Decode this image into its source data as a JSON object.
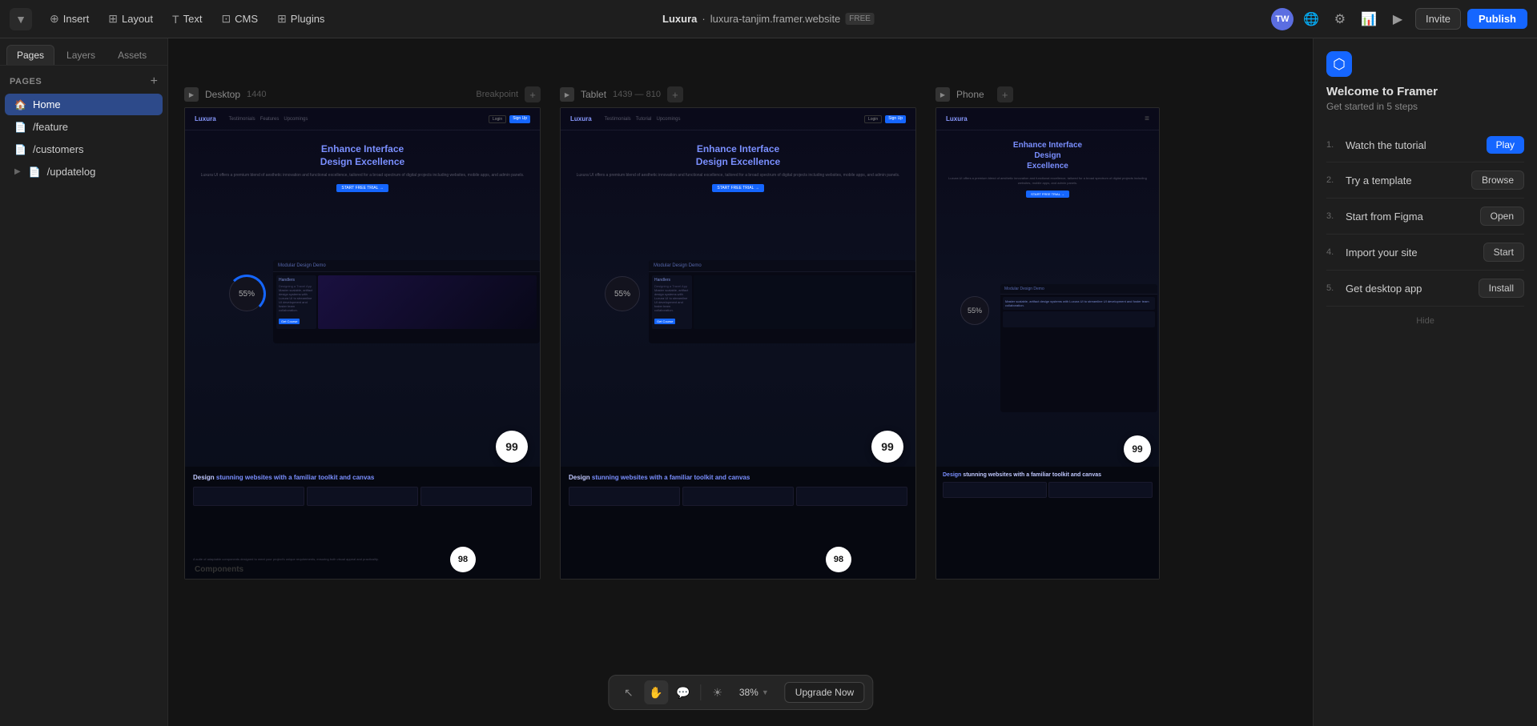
{
  "app": {
    "title": "Framer"
  },
  "topnav": {
    "logo_label": "▼",
    "insert_label": "Insert",
    "layout_label": "Layout",
    "text_label": "Text",
    "cms_label": "CMS",
    "plugins_label": "Plugins",
    "site_name": "Luxura",
    "site_url": "luxura-tanjim.framer.website",
    "site_badge": "FREE",
    "avatar_initials": "TW",
    "invite_label": "Invite",
    "publish_label": "Publish"
  },
  "sidebar": {
    "tabs": [
      "Pages",
      "Layers",
      "Assets"
    ],
    "active_tab": "Pages",
    "section_label": "Pages",
    "pages": [
      {
        "id": "home",
        "label": "Home",
        "icon": "🏠",
        "active": true
      },
      {
        "id": "feature",
        "label": "/feature",
        "icon": "📄",
        "active": false
      },
      {
        "id": "customers",
        "label": "/customers",
        "icon": "📄",
        "active": false
      },
      {
        "id": "updatelog",
        "label": "/updatelog",
        "icon": "📄",
        "active": false,
        "has_children": true
      }
    ]
  },
  "canvas": {
    "frames": [
      {
        "id": "desktop",
        "name": "Desktop",
        "size": "1440",
        "breakpoint_label": "Breakpoint",
        "score_bottom_right": "99",
        "percent": "55%"
      },
      {
        "id": "tablet",
        "name": "Tablet",
        "size": "1439 — 810",
        "score_bottom_right": "99",
        "percent": "55%"
      },
      {
        "id": "phone",
        "name": "Phone",
        "size": "",
        "score_bottom_right": "99",
        "percent": "55%"
      }
    ],
    "hero_title": "Enhance Interface Design",
    "hero_highlight": "Excellence",
    "hero_sub": "Luxura UI offers a premium blend of aesthetic innovation and functional excellence, tailored for a broad spectrum of digital projects including websites, mobile apps, and admin panels.",
    "cta_label": "START FREE TRIAL →",
    "bottom_title": "Design",
    "bottom_title_rest": "stunning websites with a familiar toolkit and canvas",
    "score_98": "98",
    "score_99": "99"
  },
  "toolbar": {
    "zoom": "38%",
    "upgrade_label": "Upgrade Now",
    "tools": [
      "cursor",
      "hand",
      "comment",
      "sun"
    ]
  },
  "welcome": {
    "logo": "⬡",
    "title": "Welcome to Framer",
    "subtitle": "Get started in 5 steps",
    "steps": [
      {
        "num": "1.",
        "label": "Watch the tutorial",
        "btn_label": "Play",
        "btn_type": "primary"
      },
      {
        "num": "2.",
        "label": "Try a template",
        "btn_label": "Browse",
        "btn_type": "secondary"
      },
      {
        "num": "3.",
        "label": "Start from Figma",
        "btn_label": "Open",
        "btn_type": "secondary"
      },
      {
        "num": "4.",
        "label": "Import your site",
        "btn_label": "Start",
        "btn_type": "secondary"
      },
      {
        "num": "5.",
        "label": "Get desktop app",
        "btn_label": "Install",
        "btn_type": "secondary"
      }
    ],
    "hide_label": "Hide"
  }
}
